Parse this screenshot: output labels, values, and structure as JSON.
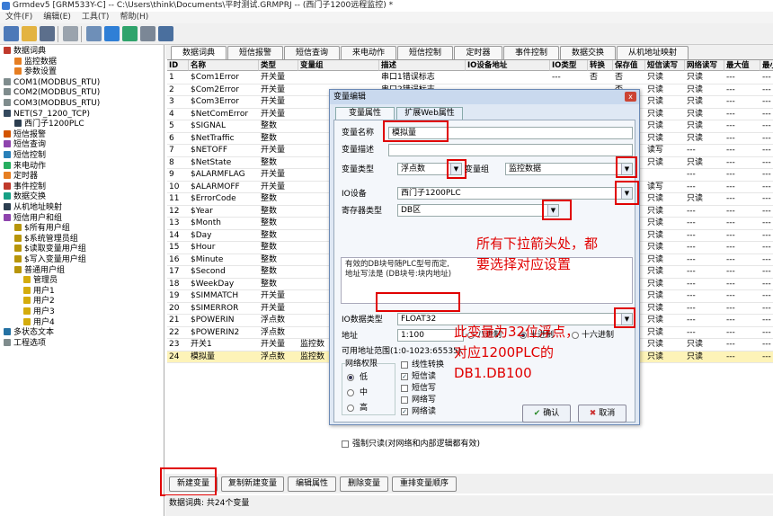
{
  "window": {
    "title": "Grmdev5 [GRM533Y-C]  -- C:\\Users\\think\\Documents\\平时测试.GRMPRJ -- (西门子1200远程监控) *"
  },
  "menu": [
    "文件(F)",
    "编辑(E)",
    "工具(T)",
    "帮助(H)"
  ],
  "tree": [
    {
      "label": "数据词典",
      "indent": 1,
      "color": "#c0392b"
    },
    {
      "label": "监控数据",
      "indent": 2,
      "color": "#e67e22"
    },
    {
      "label": "参数设置",
      "indent": 2,
      "color": "#e67e22"
    },
    {
      "label": "COM1(MODBUS_RTU)",
      "indent": 1,
      "color": "#7f8c8d"
    },
    {
      "label": "COM2(MODBUS_RTU)",
      "indent": 1,
      "color": "#7f8c8d"
    },
    {
      "label": "COM3(MODBUS_RTU)",
      "indent": 1,
      "color": "#7f8c8d"
    },
    {
      "label": "NET(S7_1200_TCP)",
      "indent": 1,
      "color": "#34495e"
    },
    {
      "label": "西门子1200PLC",
      "indent": 2,
      "color": "#2c3e50"
    },
    {
      "label": "短信报警",
      "indent": 1,
      "color": "#d35400"
    },
    {
      "label": "短信查询",
      "indent": 1,
      "color": "#8e44ad"
    },
    {
      "label": "短信控制",
      "indent": 1,
      "color": "#2980b9"
    },
    {
      "label": "来电动作",
      "indent": 1,
      "color": "#27ae60"
    },
    {
      "label": "定时器",
      "indent": 1,
      "color": "#e67e22"
    },
    {
      "label": "事件控制",
      "indent": 1,
      "color": "#c0392b"
    },
    {
      "label": "数据交换",
      "indent": 1,
      "color": "#16a085"
    },
    {
      "label": "从机地址映射",
      "indent": 1,
      "color": "#2c3e50"
    },
    {
      "label": "短信用户和组",
      "indent": 1,
      "color": "#8e44ad"
    },
    {
      "label": "$所有用户组",
      "indent": 2,
      "color": "#b7950b"
    },
    {
      "label": "$系统管理员组",
      "indent": 2,
      "color": "#b7950b"
    },
    {
      "label": "$读取变量用户组",
      "indent": 2,
      "color": "#b7950b"
    },
    {
      "label": "$写入变量用户组",
      "indent": 2,
      "color": "#b7950b"
    },
    {
      "label": "普通用户组",
      "indent": 2,
      "color": "#b7950b"
    },
    {
      "label": "管理员",
      "indent": 3,
      "color": "#d4ac0d"
    },
    {
      "label": "用户1",
      "indent": 3,
      "color": "#d4ac0d"
    },
    {
      "label": "用户2",
      "indent": 3,
      "color": "#d4ac0d"
    },
    {
      "label": "用户3",
      "indent": 3,
      "color": "#d4ac0d"
    },
    {
      "label": "用户4",
      "indent": 3,
      "color": "#d4ac0d"
    },
    {
      "label": "多状态文本",
      "indent": 1,
      "color": "#2471a3"
    },
    {
      "label": "工程选项",
      "indent": 1,
      "color": "#7f8c8d"
    }
  ],
  "tabs": [
    "数据词典",
    "短信报警",
    "短信查询",
    "来电动作",
    "短信控制",
    "定时器",
    "事件控制",
    "数据交换",
    "从机地址映射"
  ],
  "columns": [
    "ID",
    "名称",
    "类型",
    "变量组",
    "描述",
    "IO设备地址",
    "IO类型",
    "转换",
    "保存值",
    "短信读写",
    "网络读写",
    "最大值",
    "最小"
  ],
  "rows": [
    [
      "1",
      "$Com1Error",
      "开关量",
      "",
      "串口1错误标志",
      "",
      "---",
      "否",
      "否",
      "只读",
      "只读",
      "---",
      "---"
    ],
    [
      "2",
      "$Com2Error",
      "开关量",
      "",
      "串口2错误标志",
      "",
      "",
      "",
      "否",
      "只读",
      "只读",
      "---",
      "---"
    ],
    [
      "3",
      "$Com3Error",
      "开关量",
      "",
      "",
      "",
      "",
      "",
      "",
      "只读",
      "只读",
      "---",
      "---"
    ],
    [
      "4",
      "$NetComError",
      "开关量",
      "",
      "",
      "",
      "",
      "",
      "",
      "只读",
      "只读",
      "---",
      "---"
    ],
    [
      "5",
      "$SIGNAL",
      "整数",
      "",
      "",
      "",
      "",
      "",
      "",
      "只读",
      "只读",
      "---",
      "---"
    ],
    [
      "6",
      "$NetTraffic",
      "整数",
      "",
      "",
      "",
      "",
      "",
      "",
      "只读",
      "只读",
      "---",
      "---"
    ],
    [
      "7",
      "$NETOFF",
      "开关量",
      "",
      "",
      "",
      "",
      "",
      "",
      "读写",
      "---",
      "---",
      "---"
    ],
    [
      "8",
      "$NetState",
      "整数",
      "",
      "",
      "",
      "",
      "",
      "",
      "只读",
      "只读",
      "---",
      "---"
    ],
    [
      "9",
      "$ALARMFLAG",
      "开关量",
      "",
      "",
      "",
      "",
      "",
      "",
      "",
      "---",
      "---",
      "---"
    ],
    [
      "10",
      "$ALARMOFF",
      "开关量",
      "",
      "",
      "",
      "",
      "",
      "",
      "读写",
      "---",
      "---",
      "---"
    ],
    [
      "11",
      "$ErrorCode",
      "整数",
      "",
      "",
      "",
      "",
      "",
      "",
      "只读",
      "只读",
      "---",
      "---"
    ],
    [
      "12",
      "$Year",
      "整数",
      "",
      "",
      "",
      "",
      "",
      "",
      "只读",
      "---",
      "---",
      "---"
    ],
    [
      "13",
      "$Month",
      "整数",
      "",
      "",
      "",
      "",
      "",
      "",
      "只读",
      "---",
      "---",
      "---"
    ],
    [
      "14",
      "$Day",
      "整数",
      "",
      "",
      "",
      "",
      "",
      "",
      "只读",
      "---",
      "---",
      "---"
    ],
    [
      "15",
      "$Hour",
      "整数",
      "",
      "",
      "",
      "",
      "",
      "",
      "只读",
      "---",
      "---",
      "---"
    ],
    [
      "16",
      "$Minute",
      "整数",
      "",
      "",
      "",
      "",
      "",
      "",
      "只读",
      "---",
      "---",
      "---"
    ],
    [
      "17",
      "$Second",
      "整数",
      "",
      "",
      "",
      "",
      "",
      "",
      "只读",
      "---",
      "---",
      "---"
    ],
    [
      "18",
      "$WeekDay",
      "整数",
      "",
      "",
      "",
      "",
      "",
      "",
      "只读",
      "---",
      "---",
      "---"
    ],
    [
      "19",
      "$SIMMATCH",
      "开关量",
      "",
      "",
      "",
      "",
      "",
      "",
      "只读",
      "---",
      "---",
      "---"
    ],
    [
      "20",
      "$SIMERROR",
      "开关量",
      "",
      "",
      "",
      "",
      "",
      "",
      "只读",
      "---",
      "---",
      "---"
    ],
    [
      "21",
      "$POWERIN",
      "浮点数",
      "",
      "",
      "",
      "",
      "",
      "",
      "只读",
      "---",
      "---",
      "---"
    ],
    [
      "22",
      "$POWERIN2",
      "浮点数",
      "",
      "",
      "",
      "",
      "",
      "",
      "只读",
      "---",
      "---",
      "---"
    ],
    [
      "23",
      "开关1",
      "开关量",
      "监控数",
      "",
      "",
      "",
      "",
      "",
      "只读",
      "只读",
      "---",
      "---"
    ],
    [
      "24",
      "模拟量",
      "浮点数",
      "监控数",
      "",
      "",
      "",
      "",
      "",
      "只读",
      "只读",
      "---",
      "---"
    ]
  ],
  "buttons": [
    "新建变量",
    "复制新建变量",
    "编辑属性",
    "删除变量",
    "重排变量顺序"
  ],
  "status": "数据词典: 共24个变量",
  "dialog": {
    "title": "变量编辑",
    "close": "x",
    "tabs": [
      "变量属性",
      "扩展Web属性"
    ],
    "name_label": "变量名称",
    "name_value": "模拟量",
    "desc_label": "变量描述",
    "desc_value": "",
    "type_label": "变量类型",
    "type_value": "浮点数",
    "group_label": "变量组",
    "group_value": "监控数据",
    "io_label": "IO设备",
    "io_value": "西门子1200PLC",
    "reg_label": "寄存器类型",
    "reg_value": "DB区",
    "hint_line1": "有效的DB块号随PLC型号而定,",
    "hint_line2": "地址写法是 (DB块号:块内地址)",
    "iotype_label": "IO数据类型",
    "iotype_value": "FLOAT32",
    "addr_label": "地址",
    "addr_value": "1:100",
    "radix": [
      "八进制",
      "十进制",
      "十六进制"
    ],
    "range": "可用地址范围(1:0-1023:65535)",
    "perm_label": "网络权限",
    "perm": [
      "低",
      "中",
      "高"
    ],
    "checks": [
      {
        "label": "线性转换",
        "checked": false
      },
      {
        "label": "短信读",
        "checked": true
      },
      {
        "label": "短信写",
        "checked": false
      },
      {
        "label": "网络写",
        "checked": false
      },
      {
        "label": "网络读",
        "checked": true
      }
    ],
    "force_ro": "强制只读(对网络和内部逻辑都有效)",
    "ok": "确认",
    "cancel": "取消"
  },
  "annotations": {
    "a1": "所有下拉箭头处，都",
    "a2": "要选择对应设置",
    "a3": "此变量为32位浮点，",
    "a4": "对应1200PLC的",
    "a5": "DB1.DB100"
  },
  "colors": {
    "highlight": "#e00000",
    "selected_row": "#fdf3b8"
  }
}
